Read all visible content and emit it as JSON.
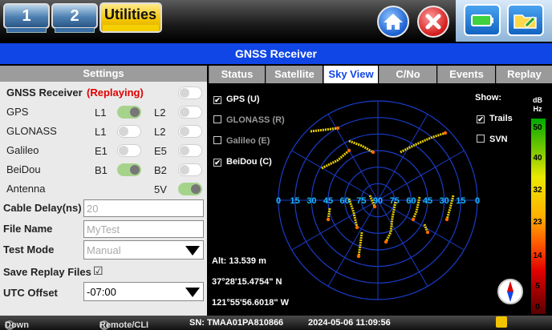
{
  "topbar": {
    "tab1": "1",
    "tab2": "2",
    "utilities": "Utilities"
  },
  "title": "GNSS Receiver",
  "settings": {
    "header": "Settings",
    "receiver_label": "GNSS Receiver",
    "replaying": "(Replaying)",
    "rows": [
      {
        "name": "GPS",
        "b1": "L1",
        "b1_on": true,
        "b2": "L2",
        "b2_on": false
      },
      {
        "name": "GLONASS",
        "b1": "L1",
        "b1_on": false,
        "b2": "L2",
        "b2_on": false
      },
      {
        "name": "Galileo",
        "b1": "E1",
        "b1_on": false,
        "b2": "E5",
        "b2_on": false
      },
      {
        "name": "BeiDou",
        "b1": "B1",
        "b1_on": true,
        "b2": "B2",
        "b2_on": false
      }
    ],
    "antenna_label": "Antenna",
    "antenna_value": "5V",
    "cable_delay_label": "Cable Delay(ns)",
    "cable_delay_value": "20",
    "file_name_label": "File Name",
    "file_name_value": "MyTest",
    "test_mode_label": "Test Mode",
    "test_mode_value": "Manual",
    "save_replay_label": "Save Replay Files",
    "save_replay_mark": "☑",
    "utc_label": "UTC Offset",
    "utc_value": "-07:00"
  },
  "tabs": [
    "Status",
    "Satellite",
    "Sky View",
    "C/No",
    "Events",
    "Replay"
  ],
  "skyview": {
    "systems": [
      {
        "label": "GPS (U)",
        "checked": true,
        "enabled": true
      },
      {
        "label": "GLONASS (R)",
        "checked": false,
        "enabled": false
      },
      {
        "label": "Galileo (E)",
        "checked": false,
        "enabled": false
      },
      {
        "label": "BeiDou (C)",
        "checked": true,
        "enabled": true
      }
    ],
    "show_label": "Show:",
    "trails_label": "Trails",
    "svn_label": "SVN",
    "elevation_ticks": [
      "0",
      "15",
      "30",
      "45",
      "60",
      "75",
      "90",
      "75",
      "60",
      "45",
      "30",
      "15",
      "0"
    ],
    "alt": "Alt: 13.539 m",
    "lat": "37°28'15.4754\" N",
    "lon": "121°55'56.6018\" W",
    "scale_unit": "dB Hz",
    "scale_labels": [
      "50",
      "40",
      "32",
      "23",
      "14",
      "5",
      "0"
    ]
  },
  "statusbar": {
    "down": "Down",
    "remote": "Remote/CLI",
    "sn": "SN: TMAA01PA810866",
    "datetime": "2024-05-06  11:09:56"
  },
  "colors": {
    "accent": "#1046e6",
    "replaying": "#e00000",
    "toggle_on": "#a6d38c"
  }
}
